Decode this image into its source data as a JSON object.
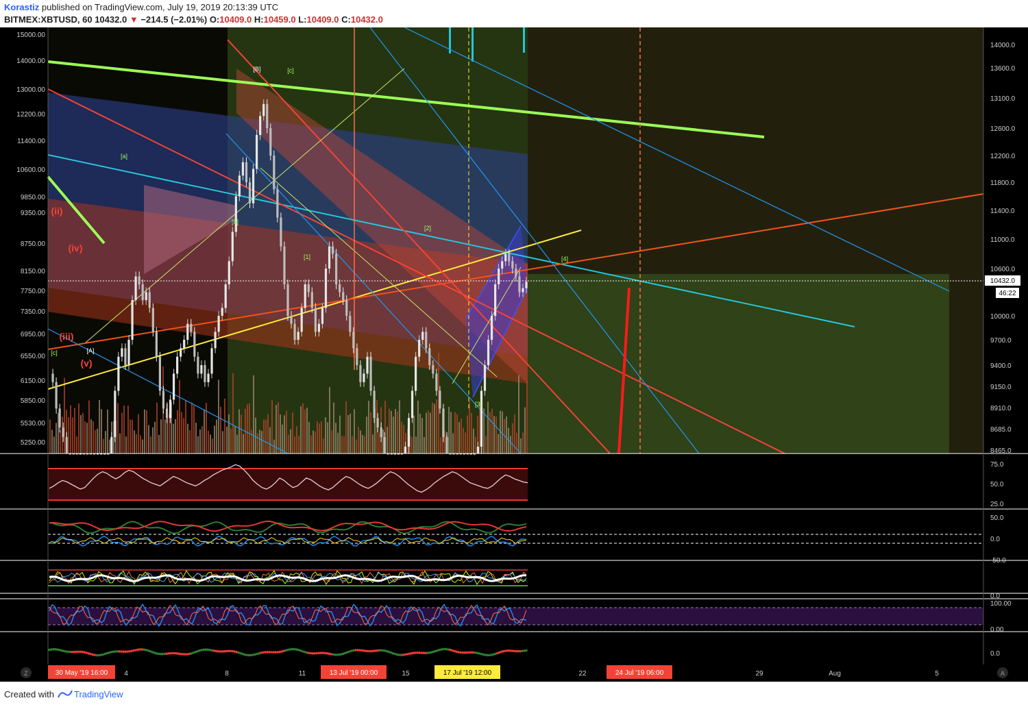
{
  "header": {
    "author": "Korastiz",
    "published": "published on TradingView.com, July 19, 2019 20:13:39 UTC",
    "symbol": "BITMEX:XBTUSD, 60",
    "last": "10432.0",
    "change": "−214.5 (−2.01%)",
    "o_label": "O:",
    "o_value": "10409.0",
    "h_label": "H:",
    "h_value": "10459.0",
    "l_label": "L:",
    "l_value": "10409.0",
    "c_label": "C:",
    "c_value": "10432.0"
  },
  "footer": {
    "created_with": "Created with",
    "logo_text": "TradingView"
  },
  "colors": {
    "background": "#000000",
    "up_candle": "#c8c8c8",
    "down_candle": "#f44336",
    "green_line": "#9cff57",
    "cyan_line": "#26c6da",
    "red_line": "#f44336",
    "yellow_line": "#ffeb3b",
    "price_tag": "#ffffff"
  },
  "chart_data": [
    {
      "type": "line",
      "panel": "price",
      "title": "",
      "symbol": "BITMEX:XBTUSD",
      "interval": "60",
      "last_price": "10432.0",
      "countdown": "46:22",
      "left_axis_ticks": [
        "15000.00",
        "14000.00",
        "13000.00",
        "12200.00",
        "11400.00",
        "10600.00",
        "9850.00",
        "9350.00",
        "8750.00",
        "8150.00",
        "7750.00",
        "7350.00",
        "6950.00",
        "6550.00",
        "6150.00",
        "5850.00",
        "5530.00",
        "5250.00"
      ],
      "right_axis_ticks": [
        "14000.0",
        "13600.0",
        "13100.0",
        "12600.0",
        "12200.0",
        "11800.0",
        "11400.0",
        "11000.0",
        "10600.0",
        "10000.0",
        "9700.0",
        "9400.0",
        "9150.0",
        "8910.0",
        "8685.0",
        "8465.0"
      ],
      "right_ylim": [
        8465,
        14100
      ],
      "x_ticks": [
        "4",
        "8",
        "11",
        "15",
        "22",
        "29",
        "Aug",
        "5"
      ],
      "x_highlight_labels": [
        "30 May '19   16:00",
        "13 Jul '19   00:00",
        "17 Jul '19   12:00",
        "24 Jul '19   06:00"
      ],
      "series": [
        {
          "values": [
            9300,
            9200,
            8900,
            8700,
            8600,
            8100,
            7800,
            7400,
            7300,
            7700,
            7600,
            7300,
            7100,
            7000,
            7200,
            7600,
            8100,
            8400,
            8600,
            9100,
            9500,
            9600,
            9400,
            9700,
            10200,
            10500,
            10400,
            10200,
            10300,
            10100,
            9800,
            9500,
            9100,
            8900,
            8800,
            9000,
            9300,
            9500,
            9600,
            9700,
            9900,
            9800,
            9500,
            9300,
            9400,
            9200,
            9300,
            9600,
            9800,
            10000,
            10100,
            10400,
            10700,
            11100,
            11600,
            11900,
            12100,
            11800,
            11500,
            12000,
            12500,
            12800,
            13000,
            12600,
            12200,
            11700,
            11300,
            10900,
            10400,
            10000,
            9900,
            9700,
            9800,
            10100,
            10400,
            10300,
            10100,
            9800,
            9900,
            10100,
            10600,
            10900,
            10800,
            10400,
            10300,
            10200,
            10000,
            9800,
            9600,
            9400,
            9200,
            9300,
            9500,
            9100,
            8800,
            8700,
            8600,
            8200,
            7900,
            7800,
            8100,
            8300,
            8200,
            8500,
            8800,
            9100,
            9500,
            9700,
            9800,
            9600,
            9400,
            9300,
            9100,
            8900,
            8600,
            8400,
            8100,
            7700,
            7500,
            7400,
            7200,
            7100,
            7400,
            7900,
            8500,
            9100,
            9400,
            9700,
            10000,
            10400,
            10600,
            10700,
            10800,
            10700,
            10600,
            10500,
            10300,
            10350,
            10432
          ]
        }
      ],
      "wave_labels": [
        "(ii)",
        "(iv)",
        "(iii)",
        "(v)",
        "[c]",
        "[A]",
        "[a]",
        "[b]",
        "[B]",
        "[c]",
        "[1]",
        "[2]",
        "[3]",
        "[4]"
      ]
    },
    {
      "type": "line",
      "panel": "rsi",
      "ticks": [
        "75.0",
        "50.0",
        "25.0"
      ],
      "ylim": [
        20,
        80
      ],
      "bands": [
        70,
        30
      ],
      "values": [
        45,
        48,
        52,
        55,
        53,
        50,
        47,
        44,
        46,
        52,
        58,
        63,
        66,
        64,
        60,
        57,
        60,
        65,
        68,
        66,
        62,
        58,
        55,
        52,
        50,
        48,
        52,
        56,
        60,
        58,
        55,
        52,
        50,
        48,
        51,
        55,
        58,
        62,
        65,
        68,
        70,
        72,
        75,
        73,
        68,
        62,
        55,
        50,
        46,
        44,
        47,
        52,
        58,
        55,
        50,
        46,
        48,
        53,
        58,
        56,
        52,
        48,
        45,
        43,
        46,
        51,
        56,
        60,
        58,
        54,
        50,
        47,
        45,
        48,
        52,
        57,
        62,
        66,
        64,
        60,
        55,
        50,
        46,
        42,
        40,
        43,
        47,
        52,
        56,
        60,
        63,
        66,
        64,
        60,
        56,
        52,
        50,
        48,
        46,
        45,
        48,
        53,
        58,
        62,
        60,
        57,
        55,
        53,
        52
      ]
    },
    {
      "type": "line",
      "panel": "oscillator",
      "ticks": [
        "50.0",
        "0.0",
        "-50.0"
      ],
      "ylim": [
        -60,
        60
      ]
    },
    {
      "type": "line",
      "panel": "multi-oscillator",
      "ticks": [
        "0.0"
      ]
    },
    {
      "type": "line",
      "panel": "stochastic",
      "ticks": [
        "100.00",
        "0.00"
      ],
      "ylim": [
        0,
        100
      ],
      "bands": [
        80,
        20
      ]
    },
    {
      "type": "line",
      "panel": "momentum",
      "ticks": [
        "0.0"
      ]
    }
  ]
}
